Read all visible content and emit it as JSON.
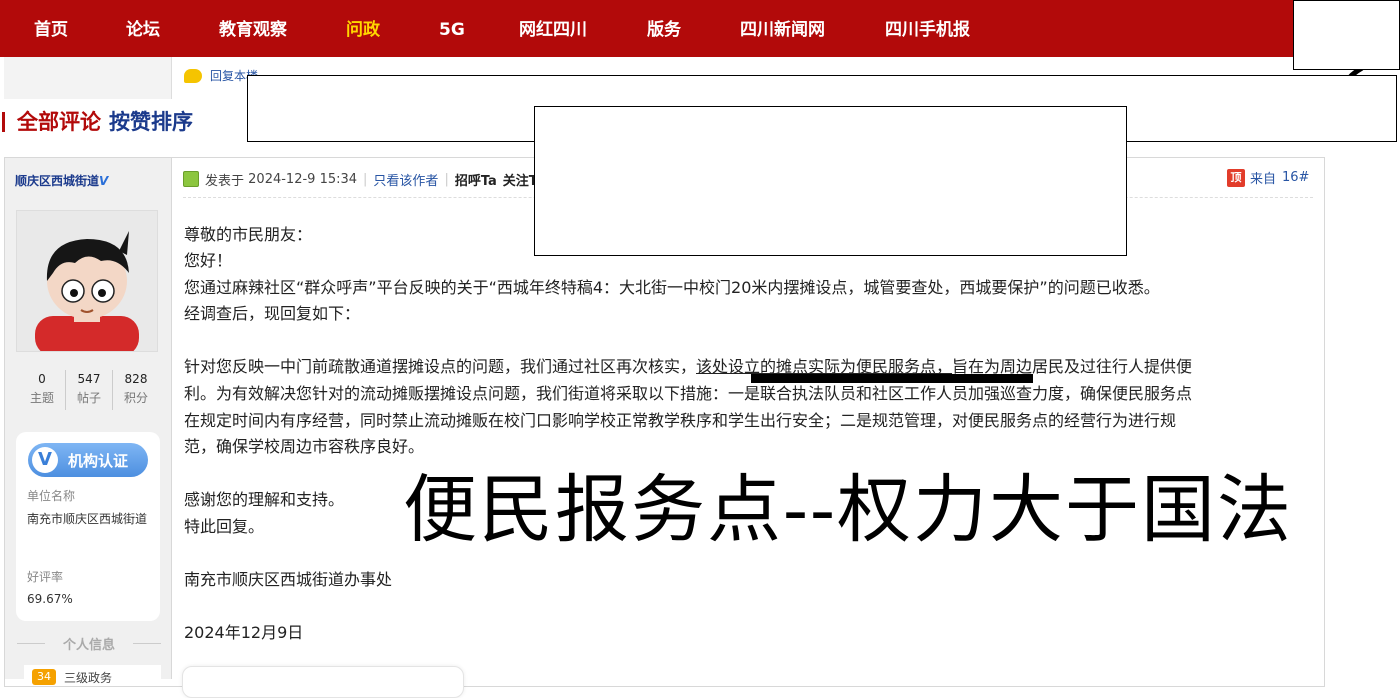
{
  "nav": {
    "items": [
      {
        "label": "首页",
        "active": false
      },
      {
        "label": "论坛",
        "active": false
      },
      {
        "label": "教育观察",
        "active": false
      },
      {
        "label": "问政",
        "active": true
      },
      {
        "label": "5G",
        "active": false
      },
      {
        "label": "网红四川",
        "active": false
      },
      {
        "label": "版务",
        "active": false
      },
      {
        "label": "四川新闻网",
        "active": false
      },
      {
        "label": "四川手机报",
        "active": false
      }
    ],
    "accent_color": "#b20a0a",
    "active_color": "#ffd700"
  },
  "reply_link": {
    "label": "回复本楼",
    "icon": "speech-bubble-icon"
  },
  "section": {
    "all_comments": "全部评论",
    "sort_by_likes": "按赞排序"
  },
  "author": {
    "name": "顺庆区西城街道",
    "verified_mark": "V",
    "stats": [
      {
        "value": "0",
        "label": "主题"
      },
      {
        "value": "547",
        "label": "帖子"
      },
      {
        "value": "828",
        "label": "积分"
      }
    ],
    "certification": {
      "badge_label": "机构认证",
      "unit_label": "单位名称",
      "unit_value": "南充市顺庆区西城街道",
      "rating_label": "好评率",
      "rating_value": "69.67%"
    },
    "personal_info_title": "个人信息",
    "level": {
      "icon_text": "34",
      "label": "三级政务"
    }
  },
  "post": {
    "posted_prefix": "发表于",
    "posted_time": "2024-12-9 15:34",
    "only_author": "只看该作者",
    "greet": "招呼Ta",
    "follow": "关注Ta",
    "top_icon_text": "顶",
    "from_label": "来自",
    "floor": "16#",
    "greeting_line1": "尊敬的市民朋友：",
    "greeting_line2": "您好！",
    "para1_line1": "您通过麻辣社区“群众呼声”平台反映的关于“西城年终特稿4：大北街一中校门20米内摆摊设点，城管要查处，西城要保护”的问题已收悉。",
    "para1_line2": "经调查后，现回复如下：",
    "para2_line1_pre": "针对您反映一中门前疏散通道摆摊设点的问题，我们通过社区再次核实，",
    "para2_line1_underlined": "该处设立的摊点实际为便民服务点，",
    "para2_line1_post": "旨在为周边居民及过往行人提供便",
    "para2_line2": "利。为有效解决您针对的流动摊贩摆摊设点问题，我们街道将采取以下措施：一是联合执法队员和社区工作人员加强巡查力度，确保便民服务点",
    "para2_line3": "在规定时间内有序经营，同时禁止流动摊贩在校门口影响学校正常教学秩序和学生出行安全；二是规范管理，对便民服务点的经营行为进行规",
    "para2_line4": "范，确保学校周边市容秩序良好。",
    "thanks": "感谢您的理解和支持。",
    "reply_close": "特此回复。",
    "signature": "南充市顺庆区西城街道办事处",
    "date": "2024年12月9日"
  },
  "overlay_caption": "便民报务点--权力大于国法"
}
